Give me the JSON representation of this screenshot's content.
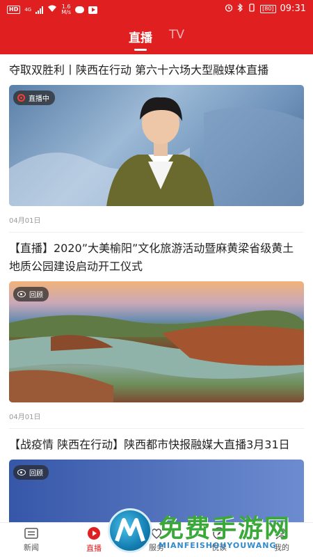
{
  "status_bar": {
    "hd": "HD",
    "network": "4G",
    "speed_top": "1.6",
    "speed_bottom": "M/s",
    "battery": "[80]",
    "time": "09:31"
  },
  "tabs": [
    {
      "label": "直播"
    },
    {
      "label": "TV"
    }
  ],
  "feed": [
    {
      "title": "夺取双胜利丨陕西在行动 第六十六场大型融媒体直播",
      "badge": "直播中",
      "date": "04月01日"
    },
    {
      "title": "【直播】2020”大美榆阳”文化旅游活动暨麻黄梁省级黄土地质公园建设启动开工仪式",
      "badge": "回顾",
      "date": "04月01日"
    },
    {
      "title": "【战疫情 陕西在行动】陕西都市快报融媒大直播3月31日",
      "badge": "回顾"
    }
  ],
  "bottom_nav": [
    {
      "label": "新闻",
      "icon": "newspaper-icon"
    },
    {
      "label": "直播",
      "icon": "play-circle-icon"
    },
    {
      "label": "服务",
      "icon": "service-icon"
    },
    {
      "label": "悦读",
      "icon": "compass-icon"
    },
    {
      "label": "我的",
      "icon": "person-icon"
    }
  ],
  "watermark": {
    "title": "免费手游网",
    "subtitle": "MIANFEISHOUYOUWANG"
  },
  "colors": {
    "brand_red": "#e02020",
    "watermark_green": "#3ba83a"
  }
}
